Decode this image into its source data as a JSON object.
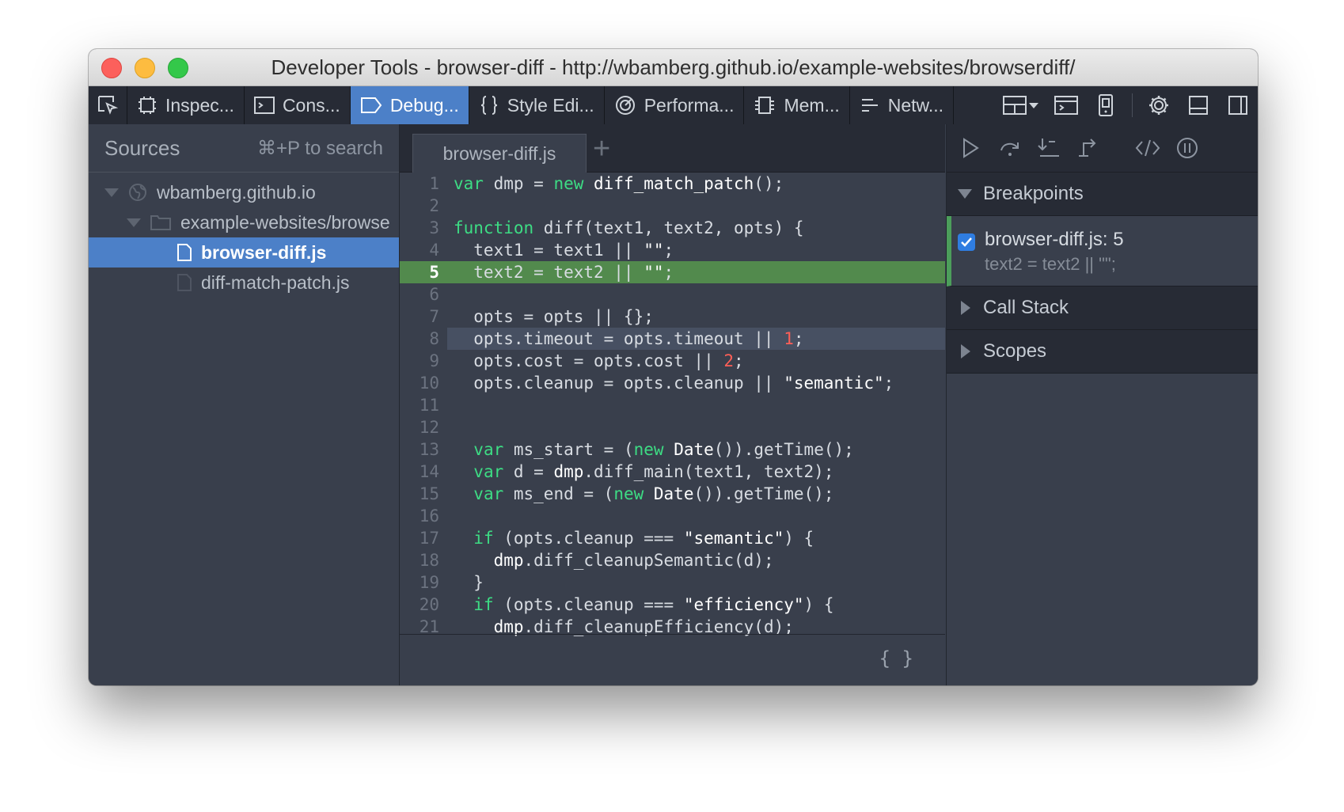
{
  "window": {
    "title": "Developer Tools - browser-diff - http://wbamberg.github.io/example-websites/browserdiff/"
  },
  "toolbar": {
    "tabs": [
      {
        "label": "Inspec...",
        "icon": "inspector-icon"
      },
      {
        "label": "Cons...",
        "icon": "console-icon"
      },
      {
        "label": "Debug...",
        "icon": "debugger-icon",
        "active": true
      },
      {
        "label": "Style Edi...",
        "icon": "style-editor-icon"
      },
      {
        "label": "Performa...",
        "icon": "performance-icon"
      },
      {
        "label": "Mem...",
        "icon": "memory-icon"
      },
      {
        "label": "Netw...",
        "icon": "network-icon"
      }
    ]
  },
  "sources": {
    "title": "Sources",
    "search_hint": "⌘+P to search",
    "tree": [
      {
        "label": "wbamberg.github.io",
        "level": 0,
        "type": "domain"
      },
      {
        "label": "example-websites/browse",
        "level": 1,
        "type": "folder"
      },
      {
        "label": "browser-diff.js",
        "level": 2,
        "type": "file",
        "selected": true
      },
      {
        "label": "diff-match-patch.js",
        "level": 2,
        "type": "file"
      }
    ]
  },
  "editor": {
    "tab_label": "browser-diff.js",
    "breakpoint_line": 5,
    "current_line": 8,
    "lines": [
      [
        {
          "t": "var",
          "c": "kw"
        },
        {
          "t": " dmp = "
        },
        {
          "t": "new",
          "c": "kw"
        },
        {
          "t": " diff_match_patch",
          "c": "str"
        },
        {
          "t": "();"
        }
      ],
      [],
      [
        {
          "t": "function",
          "c": "kw"
        },
        {
          "t": " diff(text1, text2, opts) {"
        }
      ],
      [
        {
          "t": "  text1 = text1 || "
        },
        {
          "t": "\"\"",
          "c": "str"
        },
        {
          "t": ";"
        }
      ],
      [
        {
          "t": "  text2 = text2 || "
        },
        {
          "t": "\"\"",
          "c": "str"
        },
        {
          "t": ";"
        }
      ],
      [],
      [
        {
          "t": "  opts = opts || {};"
        }
      ],
      [
        {
          "t": "  opts.timeout = opts.timeout || "
        },
        {
          "t": "1",
          "c": "num"
        },
        {
          "t": ";"
        }
      ],
      [
        {
          "t": "  opts.cost = opts.cost || "
        },
        {
          "t": "2",
          "c": "num"
        },
        {
          "t": ";"
        }
      ],
      [
        {
          "t": "  opts.cleanup = opts.cleanup || "
        },
        {
          "t": "\"semantic\"",
          "c": "str"
        },
        {
          "t": ";"
        }
      ],
      [],
      [],
      [
        {
          "t": "  "
        },
        {
          "t": "var",
          "c": "kw"
        },
        {
          "t": " ms_start = ("
        },
        {
          "t": "new",
          "c": "kw"
        },
        {
          "t": " Date",
          "c": "str"
        },
        {
          "t": "()).getTime();"
        }
      ],
      [
        {
          "t": "  "
        },
        {
          "t": "var",
          "c": "kw"
        },
        {
          "t": " d = "
        },
        {
          "t": "dmp",
          "c": "str"
        },
        {
          "t": ".diff_main(text1, text2);"
        }
      ],
      [
        {
          "t": "  "
        },
        {
          "t": "var",
          "c": "kw"
        },
        {
          "t": " ms_end = ("
        },
        {
          "t": "new",
          "c": "kw"
        },
        {
          "t": " Date",
          "c": "str"
        },
        {
          "t": "()).getTime();"
        }
      ],
      [],
      [
        {
          "t": "  "
        },
        {
          "t": "if",
          "c": "kw"
        },
        {
          "t": " (opts.cleanup === "
        },
        {
          "t": "\"semantic\"",
          "c": "str"
        },
        {
          "t": ") {"
        }
      ],
      [
        {
          "t": "    "
        },
        {
          "t": "dmp",
          "c": "str"
        },
        {
          "t": ".diff_cleanupSemantic(d);"
        }
      ],
      [
        {
          "t": "  }"
        }
      ],
      [
        {
          "t": "  "
        },
        {
          "t": "if",
          "c": "kw"
        },
        {
          "t": " (opts.cleanup === "
        },
        {
          "t": "\"efficiency\"",
          "c": "str"
        },
        {
          "t": ") {"
        }
      ],
      [
        {
          "t": "    "
        },
        {
          "t": "dmp",
          "c": "str"
        },
        {
          "t": ".diff_cleanupEfficiency(d);"
        }
      ]
    ],
    "pretty_print_label": "{ }"
  },
  "debugger": {
    "breakpoints_title": "Breakpoints",
    "breakpoint": {
      "name": "browser-diff.js: 5",
      "code": "text2 = text2 || \"\";",
      "enabled": true
    },
    "call_stack_title": "Call Stack",
    "scopes_title": "Scopes"
  }
}
